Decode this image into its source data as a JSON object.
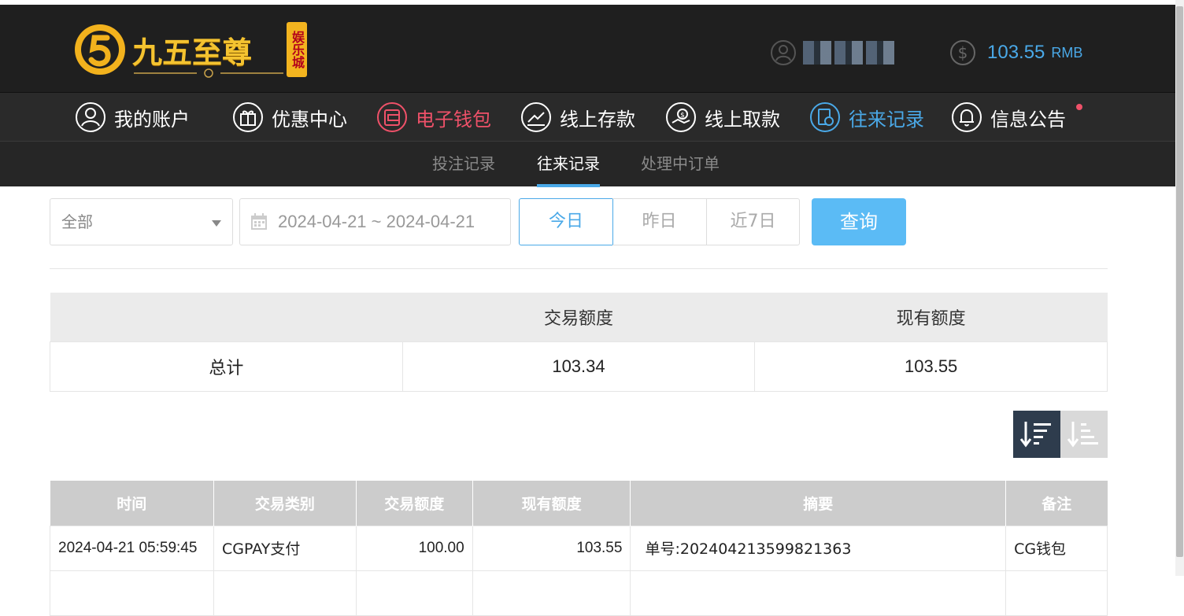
{
  "brand": {
    "name": "九五至尊",
    "sub": "娱乐城",
    "accent": "#f4c330"
  },
  "header": {
    "balance_value": "103.55",
    "balance_unit": "RMB"
  },
  "nav": {
    "items": [
      {
        "label": "我的账户",
        "icon": "user-icon"
      },
      {
        "label": "优惠中心",
        "icon": "gift-icon"
      },
      {
        "label": "电子钱包",
        "icon": "wallet-icon"
      },
      {
        "label": "线上存款",
        "icon": "deposit-icon"
      },
      {
        "label": "线上取款",
        "icon": "withdraw-icon"
      },
      {
        "label": "往来记录",
        "icon": "records-icon"
      },
      {
        "label": "信息公告",
        "icon": "bell-icon"
      }
    ]
  },
  "subnav": {
    "items": [
      "投注记录",
      "往来记录",
      "处理中订单"
    ],
    "active": "往来记录"
  },
  "filters": {
    "type_selected": "全部",
    "date_range": "2024-04-21 ~ 2024-04-21",
    "quick": [
      "今日",
      "昨日",
      "近7日"
    ],
    "quick_active": "今日",
    "query_label": "查询"
  },
  "summary": {
    "headers": [
      "",
      "交易额度",
      "现有额度"
    ],
    "row": [
      "总计",
      "103.34",
      "103.55"
    ]
  },
  "records": {
    "headers": [
      "时间",
      "交易类别",
      "交易额度",
      "现有额度",
      "摘要",
      "备注"
    ],
    "rows": [
      [
        "2024-04-21 05:59:45",
        "CGPAY支付",
        "100.00",
        "103.55",
        "单号:20240421359982136​3",
        "CG钱包"
      ]
    ]
  },
  "colors": {
    "accent_blue": "#4aa9e8",
    "accent_red": "#ef5169",
    "query_button": "#5bbbf5"
  }
}
